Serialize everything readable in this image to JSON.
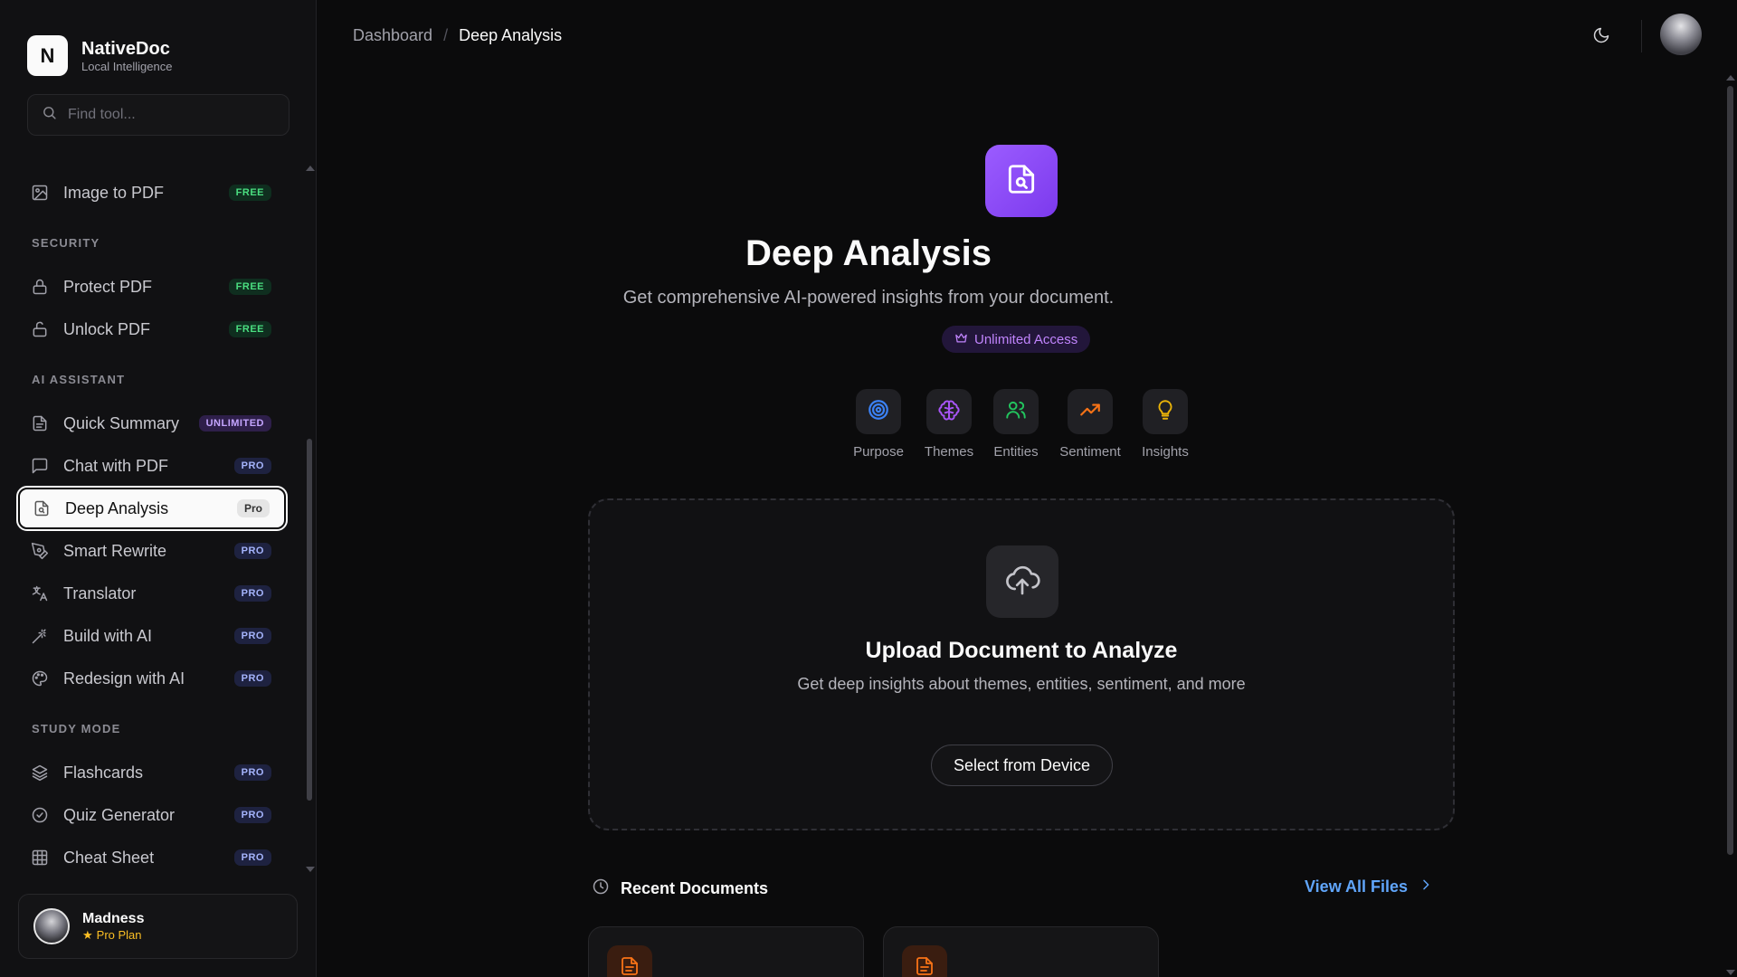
{
  "brand": {
    "logo_letter": "N",
    "name": "NativeDoc",
    "tagline": "Local Intelligence"
  },
  "search": {
    "placeholder": "Find tool..."
  },
  "sidebar": {
    "items": [
      {
        "label": "Image to PDF",
        "badge": "FREE",
        "icon": "image-icon"
      },
      {
        "label": "Protect PDF",
        "badge": "FREE",
        "icon": "lock-icon"
      },
      {
        "label": "Unlock PDF",
        "badge": "FREE",
        "icon": "unlock-icon"
      },
      {
        "label": "Quick Summary",
        "badge": "UNLIMITED",
        "icon": "file-text-icon"
      },
      {
        "label": "Chat with PDF",
        "badge": "PRO",
        "icon": "message-square-icon"
      },
      {
        "label": "Deep Analysis",
        "badge": "Pro",
        "icon": "file-search-icon",
        "active": true
      },
      {
        "label": "Smart Rewrite",
        "badge": "PRO",
        "icon": "pen-tool-icon"
      },
      {
        "label": "Translator",
        "badge": "PRO",
        "icon": "languages-icon"
      },
      {
        "label": "Build with AI",
        "badge": "PRO",
        "icon": "wand-icon"
      },
      {
        "label": "Redesign with AI",
        "badge": "PRO",
        "icon": "palette-icon"
      },
      {
        "label": "Flashcards",
        "badge": "PRO",
        "icon": "layers-icon"
      },
      {
        "label": "Quiz Generator",
        "badge": "PRO",
        "icon": "check-circle-icon"
      },
      {
        "label": "Cheat Sheet",
        "badge": "PRO",
        "icon": "table-icon"
      }
    ],
    "sections": {
      "security": "SECURITY",
      "ai_assistant": "AI ASSISTANT",
      "study_mode": "STUDY MODE"
    }
  },
  "user": {
    "name": "Madness",
    "plan": "Pro Plan"
  },
  "breadcrumb": {
    "root": "Dashboard",
    "separator": "/",
    "current": "Deep Analysis"
  },
  "hero": {
    "title": "Deep Analysis",
    "subtitle": "Get comprehensive AI-powered insights from your document.",
    "access_label": "Unlimited Access"
  },
  "features": [
    {
      "label": "Purpose",
      "icon": "target-icon",
      "color": "#3b82f6"
    },
    {
      "label": "Themes",
      "icon": "brain-icon",
      "color": "#a855f7"
    },
    {
      "label": "Entities",
      "icon": "users-icon",
      "color": "#22c55e"
    },
    {
      "label": "Sentiment",
      "icon": "trending-up-icon",
      "color": "#f97316"
    },
    {
      "label": "Insights",
      "icon": "lightbulb-icon",
      "color": "#eab308"
    }
  ],
  "upload": {
    "title": "Upload Document to Analyze",
    "description": "Get deep insights about themes, entities, sentiment, and more",
    "button_label": "Select from Device"
  },
  "recent": {
    "title": "Recent Documents",
    "view_all_label": "View All Files"
  },
  "colors": {
    "accent": "#8b5cf6",
    "background": "#0b0b0c",
    "sidebar": "#111113",
    "link": "#60a5fa"
  }
}
